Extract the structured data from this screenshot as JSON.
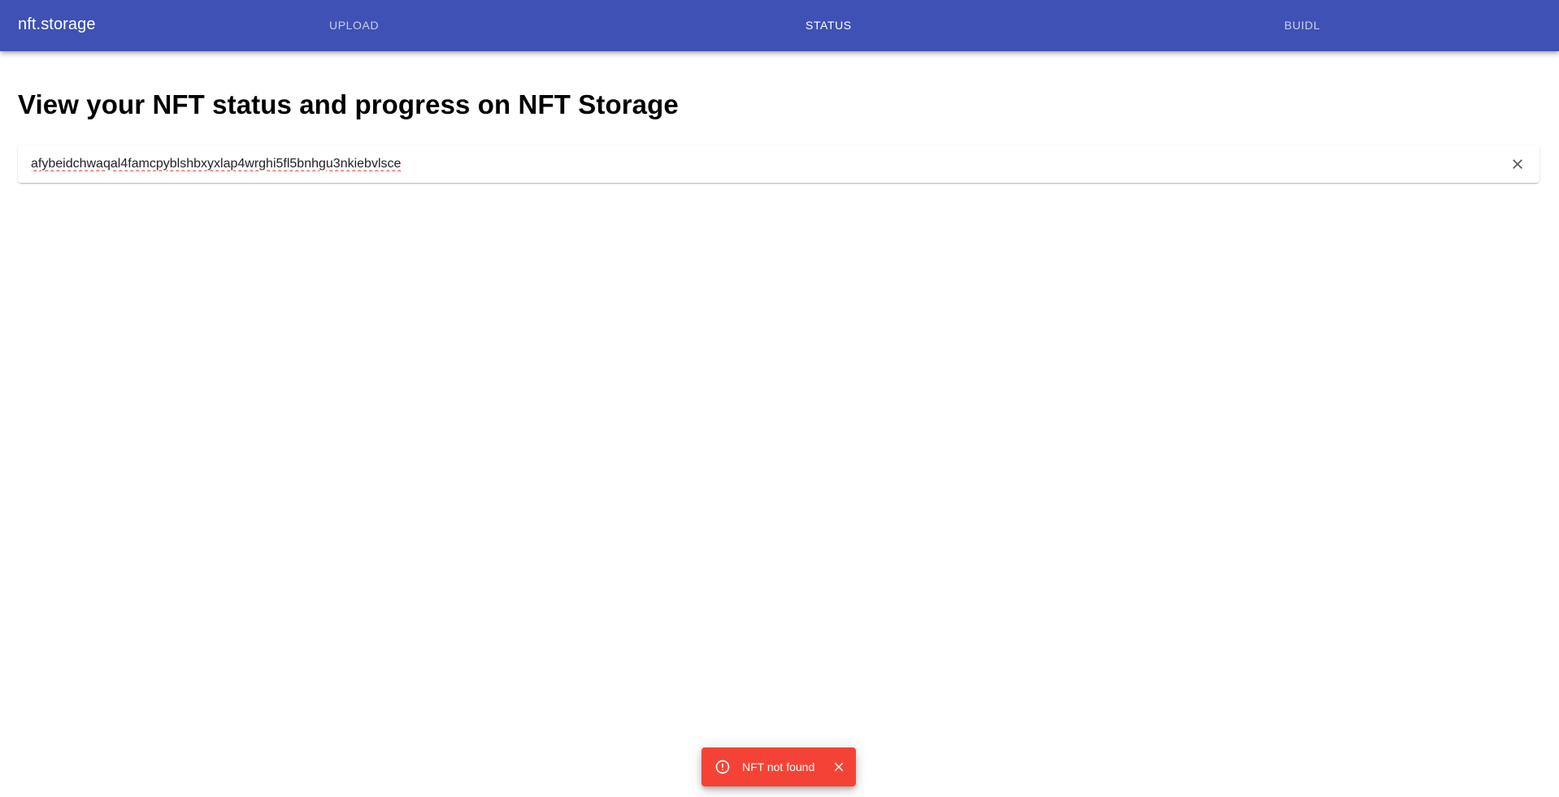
{
  "appbar": {
    "brand": "nft.storage",
    "tabs": [
      {
        "label": "UPLOAD",
        "active": false
      },
      {
        "label": "STATUS",
        "active": true
      },
      {
        "label": "BUIDL",
        "active": false
      }
    ],
    "color": "#3f51b5"
  },
  "main": {
    "title": "View your NFT status and progress on NFT Storage",
    "search": {
      "value": "afybeidchwaqal4famcpyblshbxyxlap4wrghi5fl5bnhgu3nkiebvlsce",
      "clear_icon": "close-icon"
    }
  },
  "snackbar": {
    "message": "NFT not found",
    "icon": "error-outline-icon",
    "close_icon": "close-icon",
    "color": "#f44336"
  }
}
